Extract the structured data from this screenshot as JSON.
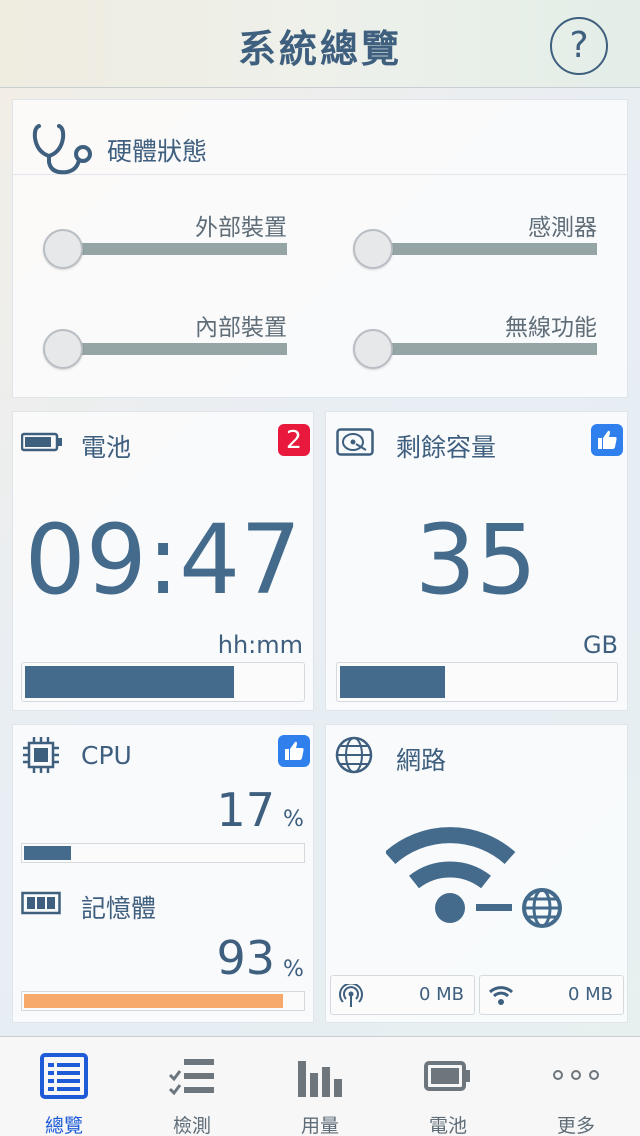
{
  "header": {
    "title": "系統總覽",
    "help_label": "?"
  },
  "hardware": {
    "title": "硬體狀態",
    "items": [
      {
        "label": "外部裝置"
      },
      {
        "label": "感測器"
      },
      {
        "label": "內部裝置"
      },
      {
        "label": "無線功能"
      }
    ]
  },
  "battery": {
    "title": "電池",
    "badge": "2",
    "value": "09:47",
    "unit": "hh:mm",
    "level": 0.75
  },
  "storage": {
    "title": "剩餘容量",
    "value": "35",
    "unit": "GB",
    "level": 0.38
  },
  "cpu": {
    "title": "CPU",
    "value": "17",
    "unit": "%",
    "level": 0.17
  },
  "memory": {
    "title": "記憶體",
    "value": "93",
    "unit": "%",
    "level": 0.93
  },
  "network": {
    "title": "網路",
    "cellular_value": "0 MB",
    "wifi_value": "0 MB"
  },
  "colors": {
    "accent": "#456b8c",
    "memory_bar": "#f7a86b",
    "badge_red": "#e8193c",
    "badge_blue": "#2f80ed",
    "tab_active": "#1e5bd6"
  },
  "tabs": [
    {
      "label": "總覽",
      "icon": "list-icon",
      "active": true
    },
    {
      "label": "檢測",
      "icon": "checklist-icon"
    },
    {
      "label": "用量",
      "icon": "bar-chart-icon"
    },
    {
      "label": "電池",
      "icon": "battery-icon"
    },
    {
      "label": "更多",
      "icon": "more-icon"
    }
  ]
}
